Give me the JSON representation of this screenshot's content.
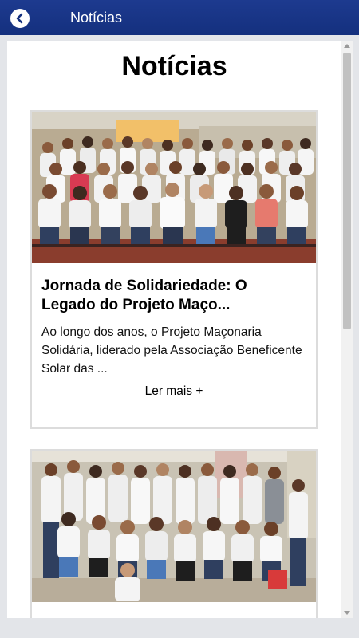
{
  "appbar": {
    "title": "Notícias"
  },
  "page": {
    "title": "Notícias"
  },
  "articles": [
    {
      "title": "Jornada de Solidariedade: O Legado do Projeto Maço...",
      "excerpt": "Ao longo dos anos, o Projeto Maçonaria Solidária, liderado pela Associação Beneficente Solar das ...",
      "read_more": "Ler mais +"
    },
    {
      "title": "",
      "excerpt": "",
      "read_more": ""
    }
  ],
  "colors": {
    "appbar": "#14307e",
    "background": "#e3e5e9",
    "card_border": "#dcdcdc"
  },
  "icons": {
    "back": "chevron-left-icon"
  }
}
